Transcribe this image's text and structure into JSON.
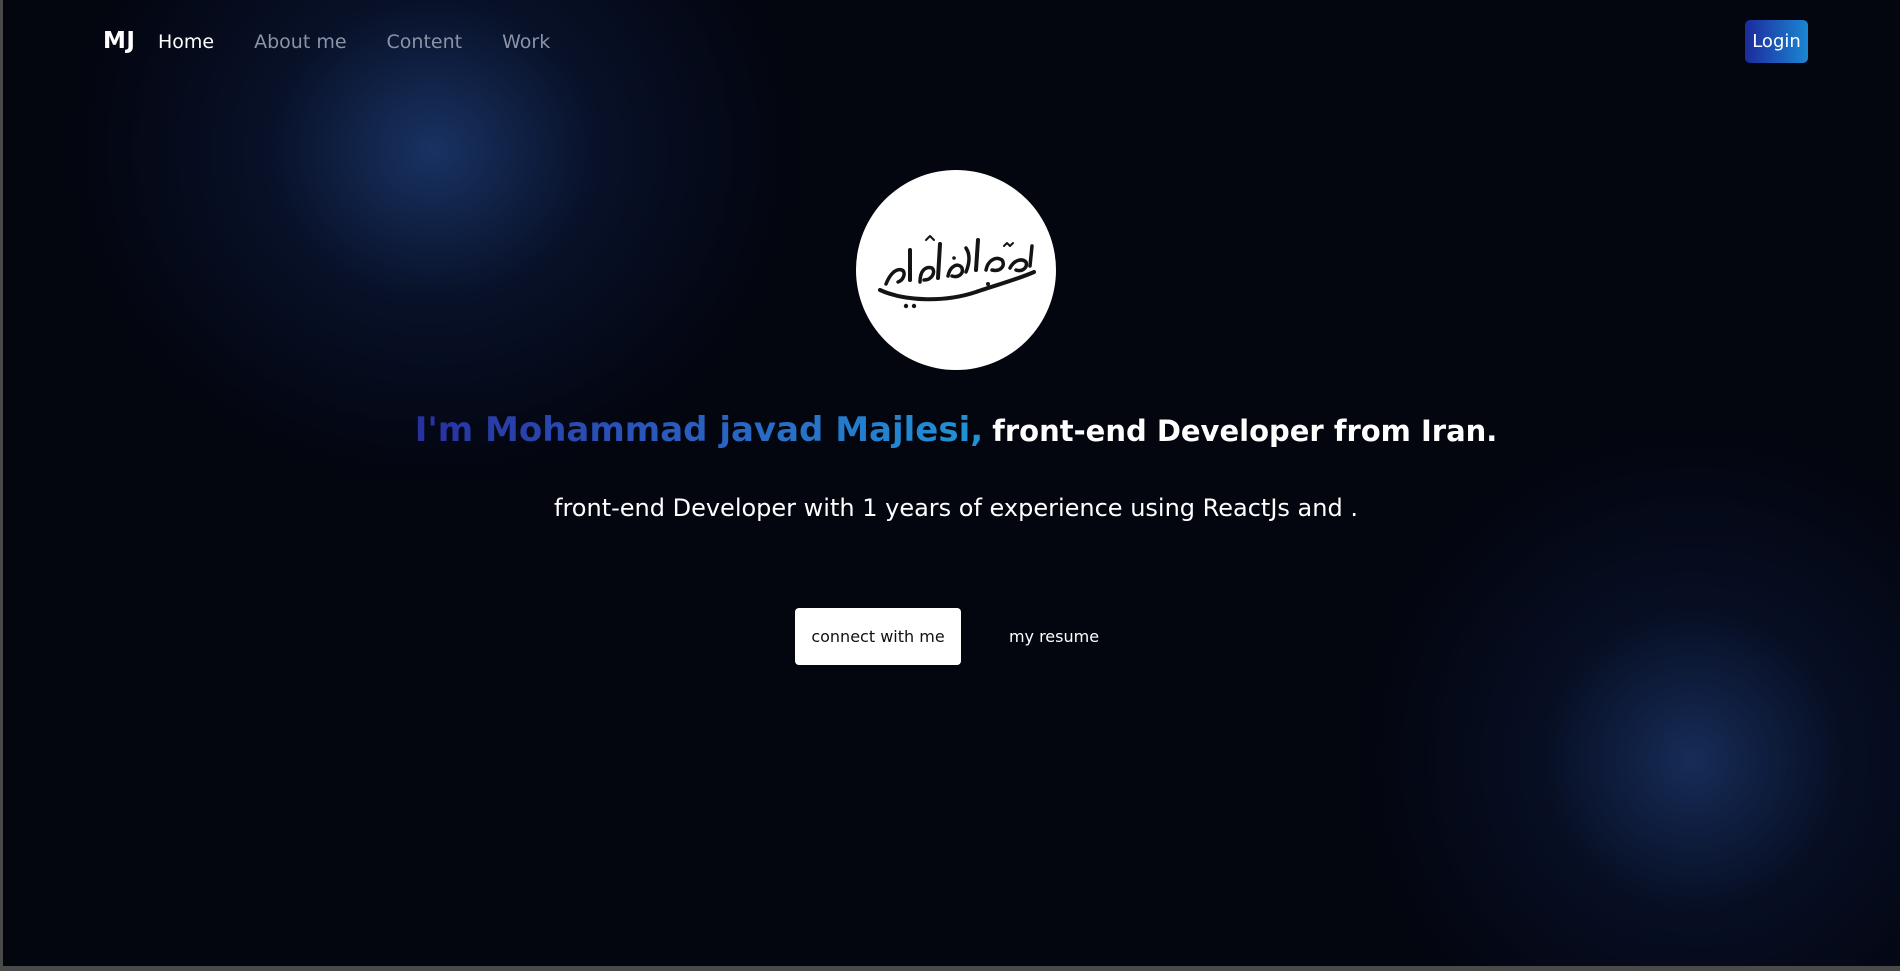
{
  "nav": {
    "logo": "MJ",
    "links": [
      {
        "label": "Home",
        "active": true
      },
      {
        "label": "About me",
        "active": false
      },
      {
        "label": "Content",
        "active": false
      },
      {
        "label": "Work",
        "active": false
      }
    ],
    "login_label": "Login"
  },
  "hero": {
    "avatar_calligraphy": "محمدجوادمجلسی",
    "name_line": "I'm Mohammad javad Majlesi,",
    "role_line": "front-end Developer from Iran.",
    "subtitle": "front-end Developer with 1 years of experience using ReactJs and .",
    "connect_label": "connect with me",
    "resume_label": "my resume"
  },
  "colors": {
    "background": "#03050f",
    "accent_start": "#1c2a9c",
    "accent_end": "#1b86d2",
    "text": "#ffffff",
    "nav_inactive": "#8c93a6"
  }
}
